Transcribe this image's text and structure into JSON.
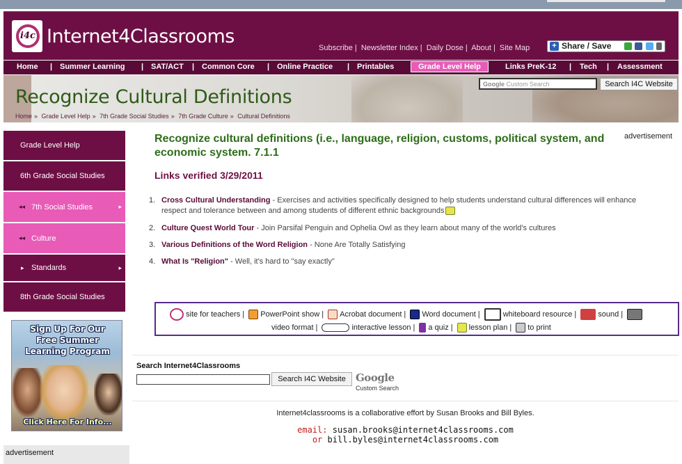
{
  "header": {
    "logo_text": "i4c",
    "site_name": "Internet4Classrooms",
    "top_links": [
      "Subscribe",
      "Newsletter Index",
      "Daily Dose",
      "About",
      "Site Map"
    ],
    "share_label": "Share / Save"
  },
  "nav": {
    "items": [
      "Home",
      "Summer Learning",
      "SAT/ACT",
      "Common Core",
      "Online Practice",
      "Printables",
      "Grade Level Help",
      "Links PreK-12",
      "Tech",
      "Assessment"
    ],
    "active": "Grade Level Help"
  },
  "banner": {
    "title": "Recognize Cultural Definitions",
    "breadcrumb": [
      "Home",
      "Grade Level Help",
      "7th Grade Social Studies",
      "7th Grade Culture",
      "Cultural Definitions"
    ],
    "search_placeholder": "Custom Search",
    "search_google": "Google",
    "search_button": "Search I4C Website"
  },
  "sidebar": {
    "items": [
      {
        "label": "Grade Level Help",
        "style": "dark"
      },
      {
        "label": "6th Grade Social Studies",
        "style": "dark"
      },
      {
        "label": "7th Social Studies",
        "style": "pink"
      },
      {
        "label": "Culture",
        "style": "pink"
      },
      {
        "label": "Standards",
        "style": "dark"
      },
      {
        "label": "8th Grade Social Studies",
        "style": "dark"
      }
    ],
    "promo_lines": [
      "Sign Up For Our",
      "Free Summer",
      "Learning Program"
    ],
    "promo_cta": "Click Here For Info...",
    "ad_label": "advertisement"
  },
  "main": {
    "title": "Recognize cultural definitions (i.e., language, religion, customs, political system, and economic system. 7.1.1",
    "verified": "Links verified 3/29/2011",
    "ad_label": "advertisement",
    "resources": [
      {
        "num": "1.",
        "link": "Cross Cultural Understanding",
        "desc": " - Exercises and activities specifically designed to help students understand cultural differences will enhance",
        "desc2": "respect and tolerance between and among students of different ethnic backgrounds"
      },
      {
        "num": "2.",
        "link": "Culture Quest World Tour",
        "desc": " - Join Parsifal Penguin and Ophelia Owl as they learn about many of the world's cultures"
      },
      {
        "num": "3.",
        "link": "Various Definitions of the Word Religion",
        "desc": " - None Are Totally Satisfying"
      },
      {
        "num": "4.",
        "link": "What Is \"Religion\"",
        "desc": " - Well, it's hard to \"say exactly\""
      }
    ]
  },
  "legend": {
    "row1": [
      "site for teachers",
      "PowerPoint show",
      "Acrobat document",
      "Word document",
      "whiteboard resource",
      "sound"
    ],
    "row2": [
      "video format",
      "interactive lesson",
      "a quiz",
      "lesson plan",
      "to print"
    ]
  },
  "footer": {
    "search_title": "Search Internet4Classrooms",
    "search_button": "Search I4C Website",
    "google_logo": "Google",
    "google_sub": "Custom Search",
    "collab": "Internet4classrooms is a collaborative effort by Susan Brooks and Bill Byles.",
    "email_label": "email:",
    "email1": "susan.brooks@internet4classrooms.com",
    "or_label": "or",
    "email2": "bill.byles@internet4classrooms.com"
  },
  "colors": {
    "brand": "#6d0f45",
    "accent_pink": "#e85bb7",
    "title_green": "#2e6d1a"
  }
}
